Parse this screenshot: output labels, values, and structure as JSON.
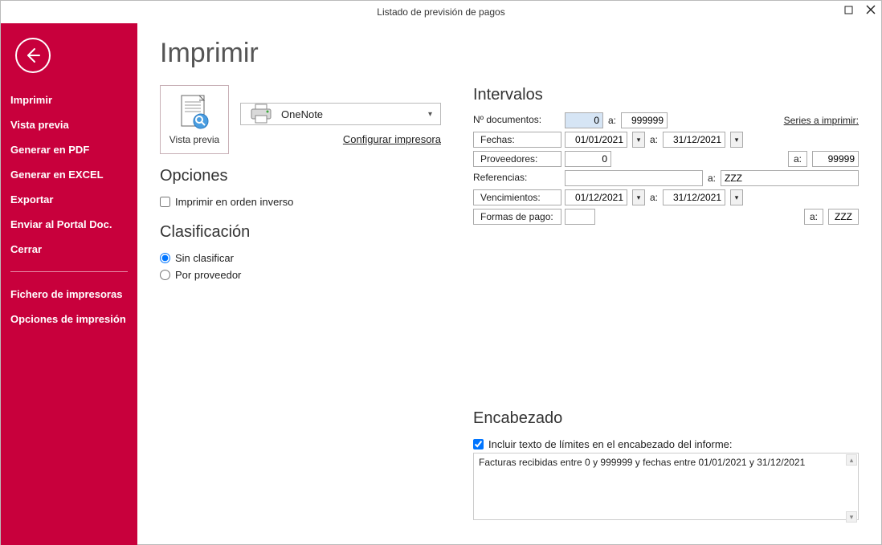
{
  "window": {
    "title": "Listado de previsión de pagos"
  },
  "sidebar": {
    "items": [
      "Imprimir",
      "Vista previa",
      "Generar en PDF",
      "Generar en EXCEL",
      "Exportar",
      "Enviar al Portal Doc.",
      "Cerrar"
    ],
    "items2": [
      "Fichero de impresoras",
      "Opciones de impresión"
    ]
  },
  "page": {
    "title": "Imprimir",
    "vista_previa": "Vista previa",
    "printer_name": "OneNote",
    "config_printer": "Configurar impresora",
    "opciones_title": "Opciones",
    "opciones_check": "Imprimir en orden inverso",
    "clasif_title": "Clasificación",
    "clasif_r1": "Sin clasificar",
    "clasif_r2": "Por proveedor"
  },
  "intervals": {
    "title": "Intervalos",
    "n_documentos_label": "Nº documentos:",
    "n_documentos_from": "0",
    "n_documentos_to": "999999",
    "a_label": "a:",
    "series_link": "Series a imprimir:",
    "fechas_label": "Fechas:",
    "fechas_from": "01/01/2021",
    "fechas_to": "31/12/2021",
    "proveedores_label": "Proveedores:",
    "proveedores_from": "0",
    "proveedores_to": "99999",
    "referencias_label": "Referencias:",
    "referencias_from": "",
    "referencias_to_label": "a:",
    "referencias_to": "ZZZ",
    "vencimientos_label": "Vencimientos:",
    "vencimientos_from": "01/12/2021",
    "vencimientos_to": "31/12/2021",
    "formas_pago_label": "Formas de pago:",
    "formas_pago_from": "",
    "formas_pago_to": "ZZZ"
  },
  "header": {
    "title": "Encabezado",
    "checkbox": "Incluir texto de límites en el encabezado del informe:",
    "text": "Facturas recibidas entre 0 y 999999 y fechas entre 01/01/2021 y 31/12/2021"
  }
}
